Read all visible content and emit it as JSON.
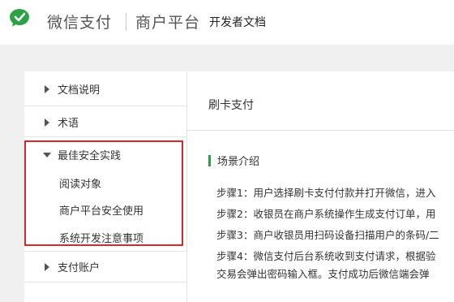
{
  "header": {
    "brand": "微信支付",
    "platform": "商户平台",
    "devdocs": "开发者文档",
    "logo_icon": "wechat-logo-icon",
    "brand_color": "#2ba245"
  },
  "sidebar": {
    "items": [
      {
        "label": "文档说明",
        "icon": "caret-right-icon"
      },
      {
        "label": "术语",
        "icon": "caret-right-icon"
      },
      {
        "label": "最佳安全实践",
        "icon": "caret-down-icon",
        "expanded": true,
        "children": [
          "阅读对象",
          "商户平台安全使用",
          "系统开发注意事项"
        ]
      },
      {
        "label": "支付账户",
        "icon": "caret-right-icon"
      }
    ],
    "highlight_color": "#d9282b"
  },
  "content": {
    "title": "刷卡支付",
    "section": "场景介绍",
    "steps": [
      "步骤1：用户选择刷卡支付付款并打开微信，进入",
      "步骤2：收银员在商户系统操作生成支付订单，用",
      "步骤3：商户收银员用扫码设备扫描用户的条码/二",
      "步骤4：微信支付后台系统收到支付请求，根据验",
      "交易会弹出密码输入框。支付成功后微信端会弹"
    ]
  }
}
